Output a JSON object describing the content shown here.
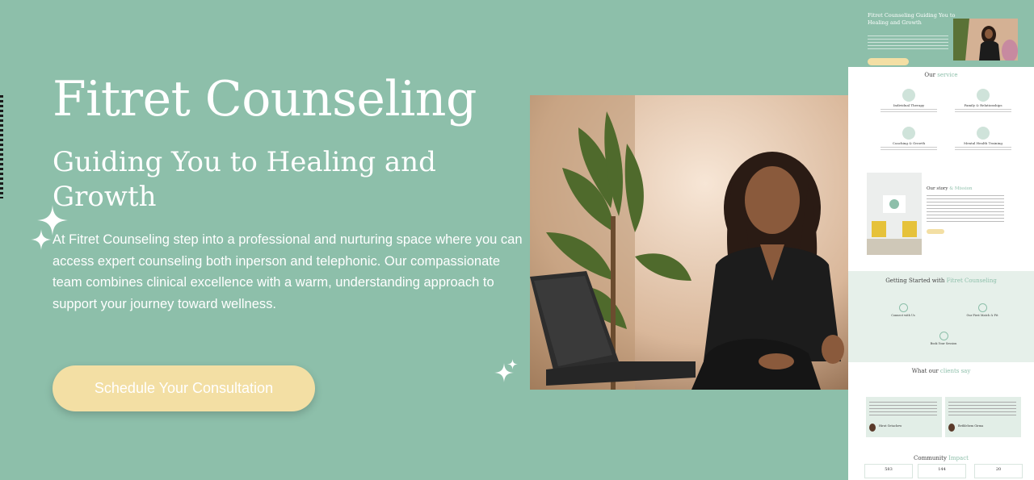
{
  "hero": {
    "title": "Fitret Counseling",
    "subtitle": "Guiding You to Healing and Growth",
    "description": "At Fitret Counseling step into a professional and nurturing space where you can access expert counseling both inperson and telephonic. Our compassionate team combines clinical excellence with a warm, understanding approach to support your journey toward wellness.",
    "cta_label": "Schedule Your Consultation",
    "image_alt": "counselor-with-laptop-photo"
  },
  "preview": {
    "hero_title": "Fitret Counseling Guiding You to Healing and Growth",
    "services_title": "Our",
    "services_title_accent": "service",
    "services": [
      {
        "label": "Individual Therapy"
      },
      {
        "label": "Family & Relationships"
      },
      {
        "label": "Coaching & Growth"
      },
      {
        "label": "Mental Health Training"
      }
    ],
    "story_title": "Our story",
    "story_title_accent": "& Mission",
    "getting_started_title": "Getting Started with",
    "getting_started_accent": "Fitret Counseling",
    "steps": [
      {
        "label": "Connect with Us"
      },
      {
        "label": "Our First Match & Fit"
      },
      {
        "label": "Book Your Session"
      }
    ],
    "clients_title": "What our",
    "clients_title_accent": "clients say",
    "testimonials": [
      {
        "name": "Hirut Getachew"
      },
      {
        "name": "Bethlehem Girma"
      }
    ],
    "community_title": "Community",
    "community_title_accent": "Impact",
    "stats": [
      {
        "value": "583"
      },
      {
        "value": "144"
      },
      {
        "value": "20"
      }
    ]
  },
  "colors": {
    "brand_green": "#8dbfaa",
    "cta_yellow": "#f3dfa4",
    "text_white": "#ffffff"
  }
}
